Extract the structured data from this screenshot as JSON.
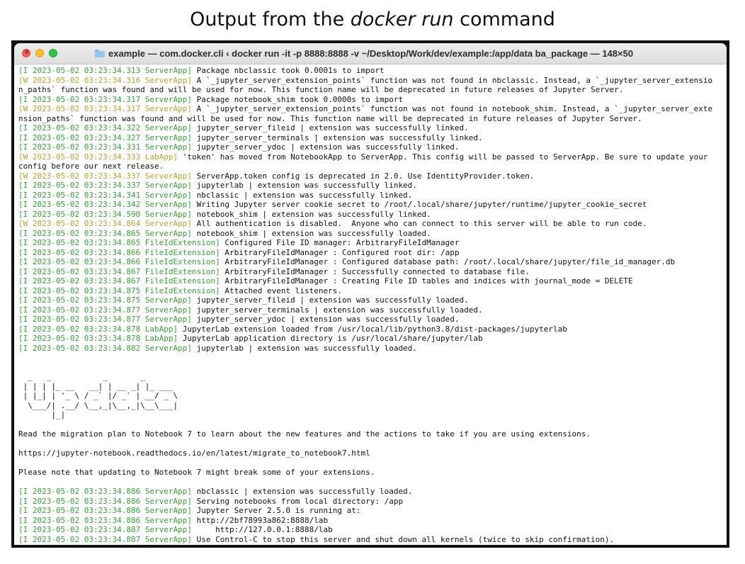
{
  "caption": {
    "before": "Output from the ",
    "command": "docker run",
    "after": " command"
  },
  "window": {
    "title": "example — com.docker.cli ‹ docker run -it -p 8888:8888 -v ~/Desktop/Work/dev/example:/app/data ba_package — 148×50",
    "close_glyph": "×"
  },
  "terminal": {
    "lines": [
      {
        "prefix": "[I 2023-05-02 03:23:34.313 ServerApp]",
        "level": "I",
        "text": " Package nbclassic took 0.0001s to import"
      },
      {
        "prefix": "[W 2023-05-02 03:23:34.316 ServerApp]",
        "level": "W",
        "text": " A `_jupyter_server_extension_points` function was not found in nbclassic. Instead, a `_jupyter_server_extensio"
      },
      {
        "prefix": "",
        "level": "",
        "text": "n_paths` function was found and will be used for now. This function name will be deprecated in future releases of Jupyter Server."
      },
      {
        "prefix": "[I 2023-05-02 03:23:34.317 ServerApp]",
        "level": "I",
        "text": " Package notebook_shim took 0.0000s to import"
      },
      {
        "prefix": "[W 2023-05-02 03:23:34.317 ServerApp]",
        "level": "W",
        "text": " A `_jupyter_server_extension_points` function was not found in notebook_shim. Instead, a `_jupyter_server_exte"
      },
      {
        "prefix": "",
        "level": "",
        "text": "nsion_paths` function was found and will be used for now. This function name will be deprecated in future releases of Jupyter Server."
      },
      {
        "prefix": "[I 2023-05-02 03:23:34.322 ServerApp]",
        "level": "I",
        "text": " jupyter_server_fileid | extension was successfully linked."
      },
      {
        "prefix": "[I 2023-05-02 03:23:34.327 ServerApp]",
        "level": "I",
        "text": " jupyter_server_terminals | extension was successfully linked."
      },
      {
        "prefix": "[I 2023-05-02 03:23:34.331 ServerApp]",
        "level": "I",
        "text": " jupyter_server_ydoc | extension was successfully linked."
      },
      {
        "prefix": "[W 2023-05-02 03:23:34.333 LabApp]",
        "level": "W",
        "text": " 'token' has moved from NotebookApp to ServerApp. This config will be passed to ServerApp. Be sure to update your"
      },
      {
        "prefix": "",
        "level": "",
        "text": "config before our next release."
      },
      {
        "prefix": "[W 2023-05-02 03:23:34.337 ServerApp]",
        "level": "W",
        "text": " ServerApp.token config is deprecated in 2.0. Use IdentityProvider.token."
      },
      {
        "prefix": "[I 2023-05-02 03:23:34.337 ServerApp]",
        "level": "I",
        "text": " jupyterlab | extension was successfully linked."
      },
      {
        "prefix": "[I 2023-05-02 03:23:34.341 ServerApp]",
        "level": "I",
        "text": " nbclassic | extension was successfully linked."
      },
      {
        "prefix": "[I 2023-05-02 03:23:34.342 ServerApp]",
        "level": "I",
        "text": " Writing Jupyter server cookie secret to /root/.local/share/jupyter/runtime/jupyter_cookie_secret"
      },
      {
        "prefix": "[I 2023-05-02 03:23:34.590 ServerApp]",
        "level": "I",
        "text": " notebook_shim | extension was successfully linked."
      },
      {
        "prefix": "[W 2023-05-02 03:23:34.864 ServerApp]",
        "level": "W",
        "text": " All authentication is disabled.  Anyone who can connect to this server will be able to run code."
      },
      {
        "prefix": "[I 2023-05-02 03:23:34.865 ServerApp]",
        "level": "I",
        "text": " notebook_shim | extension was successfully loaded."
      },
      {
        "prefix": "[I 2023-05-02 03:23:34.865 FileIdExtension]",
        "level": "I",
        "text": " Configured File ID manager: ArbitraryFileIdManager"
      },
      {
        "prefix": "[I 2023-05-02 03:23:34.866 FileIdExtension]",
        "level": "I",
        "text": " ArbitraryFileIdManager : Configured root dir: /app"
      },
      {
        "prefix": "[I 2023-05-02 03:23:34.866 FileIdExtension]",
        "level": "I",
        "text": " ArbitraryFileIdManager : Configured database path: /root/.local/share/jupyter/file_id_manager.db"
      },
      {
        "prefix": "[I 2023-05-02 03:23:34.867 FileIdExtension]",
        "level": "I",
        "text": " ArbitraryFileIdManager : Successfully connected to database file."
      },
      {
        "prefix": "[I 2023-05-02 03:23:34.867 FileIdExtension]",
        "level": "I",
        "text": " ArbitraryFileIdManager : Creating File ID tables and indices with journal_mode = DELETE"
      },
      {
        "prefix": "[I 2023-05-02 03:23:34.875 FileIdExtension]",
        "level": "I",
        "text": " Attached event listeners."
      },
      {
        "prefix": "[I 2023-05-02 03:23:34.875 ServerApp]",
        "level": "I",
        "text": " jupyter_server_fileid | extension was successfully loaded."
      },
      {
        "prefix": "[I 2023-05-02 03:23:34.877 ServerApp]",
        "level": "I",
        "text": " jupyter_server_terminals | extension was successfully loaded."
      },
      {
        "prefix": "[I 2023-05-02 03:23:34.877 ServerApp]",
        "level": "I",
        "text": " jupyter_server_ydoc | extension was successfully loaded."
      },
      {
        "prefix": "[I 2023-05-02 03:23:34.878 LabApp]",
        "level": "I",
        "text": " JupyterLab extension loaded from /usr/local/lib/python3.8/dist-packages/jupyterlab"
      },
      {
        "prefix": "[I 2023-05-02 03:23:34.878 LabApp]",
        "level": "I",
        "text": " JupyterLab application directory is /usr/local/share/jupyter/lab"
      },
      {
        "prefix": "[I 2023-05-02 03:23:34.882 ServerApp]",
        "level": "I",
        "text": " jupyterlab | extension was successfully loaded."
      },
      {
        "prefix": "",
        "level": "",
        "text": ""
      },
      {
        "prefix": "",
        "level": "",
        "text": ""
      },
      {
        "prefix": "",
        "level": "ascii",
        "text": "  _   _           _       _"
      },
      {
        "prefix": "",
        "level": "ascii",
        "text": " | | | |_ __   __| | __ _| |_ ___"
      },
      {
        "prefix": "",
        "level": "ascii",
        "text": " | |_| | '_ \\ / _` |/ _` | __/ _ \\"
      },
      {
        "prefix": "",
        "level": "ascii",
        "text": "  \\___/| .__/ \\__,_|\\__,_|\\__\\___|"
      },
      {
        "prefix": "",
        "level": "ascii",
        "text": "       |_|"
      },
      {
        "prefix": "",
        "level": "",
        "text": ""
      },
      {
        "prefix": "",
        "level": "",
        "text": "Read the migration plan to Notebook 7 to learn about the new features and the actions to take if you are using extensions."
      },
      {
        "prefix": "",
        "level": "",
        "text": ""
      },
      {
        "prefix": "",
        "level": "",
        "text": "https://jupyter-notebook.readthedocs.io/en/latest/migrate_to_notebook7.html"
      },
      {
        "prefix": "",
        "level": "",
        "text": ""
      },
      {
        "prefix": "",
        "level": "",
        "text": "Please note that updating to Notebook 7 might break some of your extensions."
      },
      {
        "prefix": "",
        "level": "",
        "text": ""
      },
      {
        "prefix": "[I 2023-05-02 03:23:34.886 ServerApp]",
        "level": "I",
        "text": " nbclassic | extension was successfully loaded."
      },
      {
        "prefix": "[I 2023-05-02 03:23:34.886 ServerApp]",
        "level": "I",
        "text": " Serving notebooks from local directory: /app"
      },
      {
        "prefix": "[I 2023-05-02 03:23:34.886 ServerApp]",
        "level": "I",
        "text": " Jupyter Server 2.5.0 is running at:"
      },
      {
        "prefix": "[I 2023-05-02 03:23:34.886 ServerApp]",
        "level": "I",
        "text": " http://2bf78993a862:8888/lab"
      },
      {
        "prefix": "[I 2023-05-02 03:23:34.887 ServerApp]",
        "level": "I",
        "text": "     http://127.0.0.1:8888/lab"
      },
      {
        "prefix": "[I 2023-05-02 03:23:34.887 ServerApp]",
        "level": "I",
        "text": " Use Control-C to stop this server and shut down all kernels (twice to skip confirmation)."
      }
    ]
  },
  "colors": {
    "info_prefix": "#35a335",
    "warning_prefix": "#b8a329"
  }
}
